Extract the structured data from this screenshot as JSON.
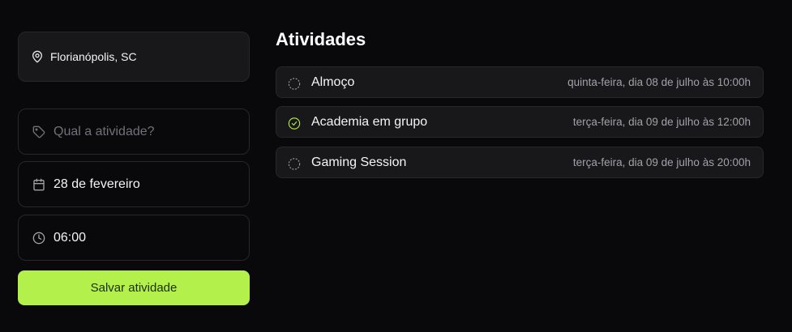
{
  "location": {
    "city": "Florianópolis, SC"
  },
  "form": {
    "activity_placeholder": "Qual a atividade?",
    "date_value": "28 de fevereiro",
    "time_value": "06:00",
    "save_label": "Salvar atividade"
  },
  "activities": {
    "title": "Atividades",
    "items": [
      {
        "name": "Almoço",
        "date": "quinta-feira, dia 08 de julho às 10:00h",
        "done": false
      },
      {
        "name": "Academia em grupo",
        "date": "terça-feira, dia 09 de julho às 12:00h",
        "done": true
      },
      {
        "name": "Gaming Session",
        "date": "terça-feira, dia 09 de julho às 20:00h",
        "done": false
      }
    ]
  },
  "colors": {
    "accent": "#b4f04b",
    "background": "#09090b",
    "card": "#18181b"
  }
}
